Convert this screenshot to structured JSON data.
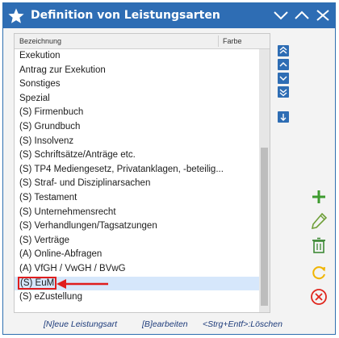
{
  "window": {
    "title": "Definition von Leistungsarten"
  },
  "list": {
    "column_headers": {
      "name": "Bezeichnung",
      "color": "Farbe"
    },
    "items": [
      "Exekution",
      "Antrag zur Exekution",
      "Sonstiges",
      "Spezial",
      "(S) Firmenbuch",
      "(S) Grundbuch",
      "(S) Insolvenz",
      "(S) Schriftsätze/Anträge etc.",
      "(S) TP4 Mediengesetz, Privatanklagen, -beteilig...",
      "(S) Straf- und Disziplinarsachen",
      "(S) Testament",
      "(S) Unternehmensrecht",
      "(S) Verhandlungen/Tagsatzungen",
      "(S) Verträge",
      "(A) Online-Abfragen",
      "(A) VfGH / VwGH / BVwG",
      "(S) EuM",
      "(S) eZustellung"
    ],
    "selected_item": "(S) EuM"
  },
  "footer": {
    "new": "[N]eue Leistungsart",
    "edit": "[B]earbeiten",
    "delete": "<Strg+Entf>:Löschen"
  },
  "icons": {
    "title": "star-icon",
    "window_controls": [
      "chevron-down-icon",
      "chevron-up-icon",
      "close-icon"
    ],
    "move_controls": [
      "move-to-top-icon",
      "move-up-icon",
      "move-down-icon",
      "move-to-bottom-icon",
      "sort-down-icon"
    ],
    "actions": [
      "add-icon",
      "edit-icon",
      "delete-icon",
      "refresh-icon",
      "cancel-icon"
    ]
  },
  "colors": {
    "titlebar": "#2e6db4",
    "selection": "#d6e7fb",
    "highlight": "#e01d1d",
    "add": "#3e9b2f",
    "edit": "#6e9f38",
    "delete": "#3e8a36",
    "refresh": "#f0b400",
    "cancel": "#e0261d"
  }
}
